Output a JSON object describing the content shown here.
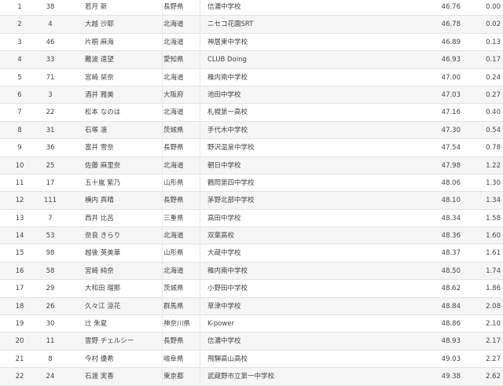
{
  "rows": [
    {
      "rank": "1",
      "bib": "38",
      "name": "若月 新",
      "pref": "長野県",
      "team": "信濃中学校",
      "time": "46.76",
      "diff": "0.00"
    },
    {
      "rank": "2",
      "bib": "4",
      "name": "大越 沙耶",
      "pref": "北海道",
      "team": "ニセコ花園SRT",
      "time": "46.78",
      "diff": "0.02"
    },
    {
      "rank": "3",
      "bib": "46",
      "name": "片桐 麻海",
      "pref": "北海道",
      "team": "神居東中学校",
      "time": "46.89",
      "diff": "0.13"
    },
    {
      "rank": "4",
      "bib": "33",
      "name": "難波 遠望",
      "pref": "愛知県",
      "team": "CLUB Doing",
      "time": "46.93",
      "diff": "0.17"
    },
    {
      "rank": "5",
      "bib": "71",
      "name": "宮崎 栞奈",
      "pref": "北海道",
      "team": "稚内南中学校",
      "time": "47.00",
      "diff": "0.24"
    },
    {
      "rank": "6",
      "bib": "3",
      "name": "酒井 雅美",
      "pref": "大阪府",
      "team": "池田中学校",
      "time": "47.03",
      "diff": "0.27"
    },
    {
      "rank": "7",
      "bib": "22",
      "name": "松本 なのは",
      "pref": "北海道",
      "team": "札幌第一高校",
      "time": "47.16",
      "diff": "0.40"
    },
    {
      "rank": "8",
      "bib": "31",
      "name": "石塚 凛",
      "pref": "茨城県",
      "team": "手代木中学校",
      "time": "47.30",
      "diff": "0.54"
    },
    {
      "rank": "9",
      "bib": "36",
      "name": "富井 雪奈",
      "pref": "長野県",
      "team": "野沢温泉中学校",
      "time": "47.54",
      "diff": "0.78"
    },
    {
      "rank": "10",
      "bib": "25",
      "name": "佐藤 麻里奈",
      "pref": "北海道",
      "team": "朝日中学校",
      "time": "47.98",
      "diff": "1.22"
    },
    {
      "rank": "11",
      "bib": "17",
      "name": "五十嵐 紫乃",
      "pref": "山形県",
      "team": "鶴岡第四中学校",
      "time": "48.06",
      "diff": "1.30"
    },
    {
      "rank": "12",
      "bib": "111",
      "name": "横内 真晴",
      "pref": "長野県",
      "team": "茅野北部中学校",
      "time": "48.10",
      "diff": "1.34"
    },
    {
      "rank": "13",
      "bib": "7",
      "name": "西井 比呂",
      "pref": "三重県",
      "team": "高田中学校",
      "time": "48.34",
      "diff": "1.58"
    },
    {
      "rank": "14",
      "bib": "53",
      "name": "奈良 きらり",
      "pref": "北海道",
      "team": "双葉高校",
      "time": "48.36",
      "diff": "1.60"
    },
    {
      "rank": "15",
      "bib": "98",
      "name": "越後 英美華",
      "pref": "山形県",
      "team": "大蔵中学校",
      "time": "48.37",
      "diff": "1.61"
    },
    {
      "rank": "16",
      "bib": "58",
      "name": "宮崎 純奈",
      "pref": "北海道",
      "team": "稚内南中学校",
      "time": "48.50",
      "diff": "1.74"
    },
    {
      "rank": "17",
      "bib": "29",
      "name": "大和田 瑠那",
      "pref": "茨城県",
      "team": "小野田中学校",
      "time": "48.62",
      "diff": "1.86"
    },
    {
      "rank": "18",
      "bib": "26",
      "name": "久々江 涼花",
      "pref": "群馬県",
      "team": "草津中学校",
      "time": "48.84",
      "diff": "2.08"
    },
    {
      "rank": "19",
      "bib": "30",
      "name": "辻 朱夏",
      "pref": "神奈川県",
      "team": "K-power",
      "time": "48.86",
      "diff": "2.10"
    },
    {
      "rank": "20",
      "bib": "11",
      "name": "雲野 チェルシー",
      "pref": "長野県",
      "team": "信濃中学校",
      "time": "48.93",
      "diff": "2.17"
    },
    {
      "rank": "21",
      "bib": "8",
      "name": "今村 優希",
      "pref": "岐阜県",
      "team": "飛騨高山高校",
      "time": "49.03",
      "diff": "2.27"
    },
    {
      "rank": "22",
      "bib": "24",
      "name": "石渡 実香",
      "pref": "東京都",
      "team": "武蔵野市立第一中学校",
      "time": "49.38",
      "diff": "2.62"
    }
  ]
}
